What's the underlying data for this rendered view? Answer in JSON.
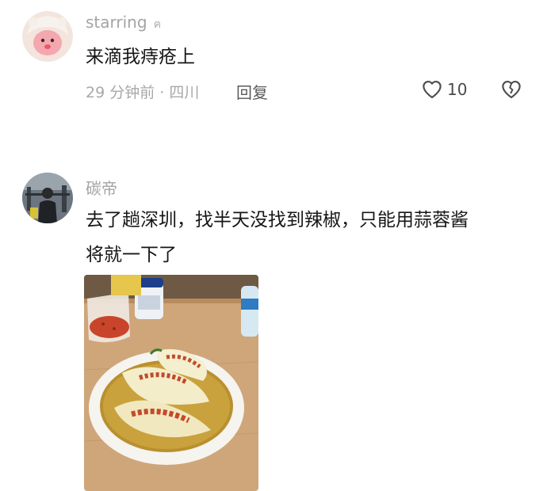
{
  "comments": [
    {
      "username": "starring",
      "badge_icon": "author-badge-icon",
      "text": "来滴我痔疮上",
      "time_location": "29 分钟前 · 四川",
      "reply_label": "回复",
      "like_count": "10"
    },
    {
      "username": "碳帝",
      "text_line1": "去了趟深圳，找半天没找到辣椒，只能用蒜蓉酱",
      "text_line2": "将就一下了",
      "photo_icon": "food-photo"
    }
  ]
}
